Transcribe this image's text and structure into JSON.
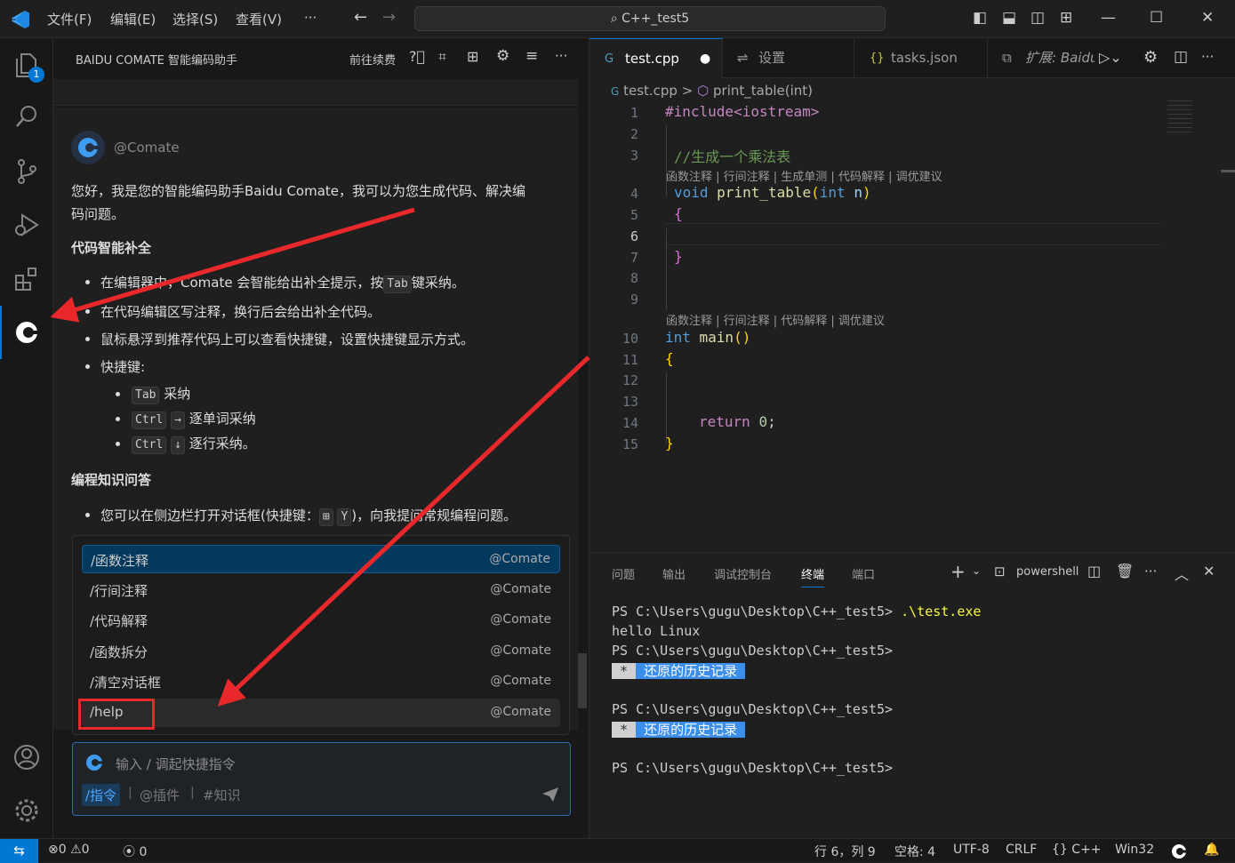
{
  "menu": {
    "file": "文件(F)",
    "edit": "编辑(E)",
    "selection": "选择(S)",
    "view": "查看(V)",
    "more": "···"
  },
  "search": {
    "text": "C++_test5"
  },
  "activity": {
    "explorer_badge": "1"
  },
  "left_panel": {
    "title": "BAIDU COMATE 智能编码助手",
    "renew": "前往续费",
    "bot_name": "@Comate",
    "intro": "您好，我是您的智能编码助手Baidu Comate，我可以为您生成代码、解决编",
    "intro2": "码问题。",
    "sec1": "代码智能补全",
    "b1a": "在编辑器中，Comate 会智能给出补全提示，按",
    "b1k": "Tab",
    "b1b": "键采纳。",
    "b2": "在代码编辑区写注释，换行后会给出补全代码。",
    "b3": "鼠标悬浮到推荐代码上可以查看快捷键，设置快捷键显示方式。",
    "b4": "快捷键:",
    "s1k": "Tab",
    "s1t": "采纳",
    "s2k": "Ctrl",
    "s2k2": "→",
    "s2t": "逐单词采纳",
    "s3k": "Ctrl",
    "s3k2": "↓",
    "s3t": "逐行采纳。",
    "sec2": "编程知识问答",
    "b5a": "您可以在侧边栏打开对话框(快捷键：",
    "b5k": "Y",
    "b5b": ")，向我提问常规编程问题。"
  },
  "popup": {
    "items": [
      {
        "name": "/函数注释",
        "src": "@Comate"
      },
      {
        "name": "/行间注释",
        "src": "@Comate"
      },
      {
        "name": "/代码解释",
        "src": "@Comate"
      },
      {
        "name": "/函数拆分",
        "src": "@Comate"
      },
      {
        "name": "/清空对话框",
        "src": "@Comate"
      },
      {
        "name": "/help",
        "src": "@Comate"
      }
    ]
  },
  "input": {
    "placeholder": "输入 / 调起快捷指令",
    "tag_cmd": "/指令",
    "tag_plugin": "@插件",
    "tag_know": "#知识",
    "sep": "|"
  },
  "tabs": [
    {
      "label": "test.cpp",
      "dot": "●"
    },
    {
      "label": "设置"
    },
    {
      "label": "tasks.json"
    },
    {
      "label": "扩展: Baidu"
    }
  ],
  "breadcrumb": {
    "file": "test.cpp",
    "sep": ">",
    "symbol": "print_table(int)"
  },
  "code": {
    "l1": "#include<iostream>",
    "l3": "//生成一个乘法表",
    "lens1": "函数注释 | 行间注释 | 生成单测 | 代码解释 | 调优建议",
    "l4a": "void ",
    "l4b": "print_table",
    "l4c": "(",
    "l4d": "int ",
    "l4e": "n",
    ")": ")",
    "l5": "{",
    "l7": "}",
    "lens2": "函数注释 | 行间注释 | 代码解释 | 调优建议",
    "l10a": "int ",
    "l10b": "main",
    "l10c": "()",
    "l11": "{",
    "l14a": "return ",
    "l14b": "0",
    ";": ";",
    "l15": "}",
    "lines": [
      "1",
      "2",
      "3",
      "4",
      "5",
      "6",
      "7",
      "8",
      "9",
      "10",
      "11",
      "12",
      "13",
      "14",
      "15"
    ]
  },
  "terminal": {
    "tabs": [
      "问题",
      "输出",
      "调试控制台",
      "终端",
      "端口"
    ],
    "shell": "powershell",
    "line1p": "PS C:\\Users\\gugu\\Desktop\\C++_test5> ",
    "line1c": ".\\test.exe",
    "line2": "hello Linux",
    "line3": "PS C:\\Users\\gugu\\Desktop\\C++_test5>",
    "hist_star": " * ",
    "hist_text": " 还原的历史记录 ",
    "line5": "PS C:\\Users\\gugu\\Desktop\\C++_test5>",
    "line7": "PS C:\\Users\\gugu\\Desktop\\C++_test5>"
  },
  "status": {
    "errors": "0",
    "warnings": "0",
    "ports": "0",
    "pos": "行 6，列 9",
    "spaces": "空格: 4",
    "enc": "UTF-8",
    "eol": "CRLF",
    "lang": "{} C++",
    "plat": "Win32"
  },
  "colors": {
    "accent": "#0078d4",
    "arrow": "#e8282b",
    "keyword": "#569cd6",
    "func": "#dcdcaa",
    "comment": "#6a9955",
    "string": "#ce9178",
    "include": "#c586c0",
    "number": "#b5cea8"
  }
}
